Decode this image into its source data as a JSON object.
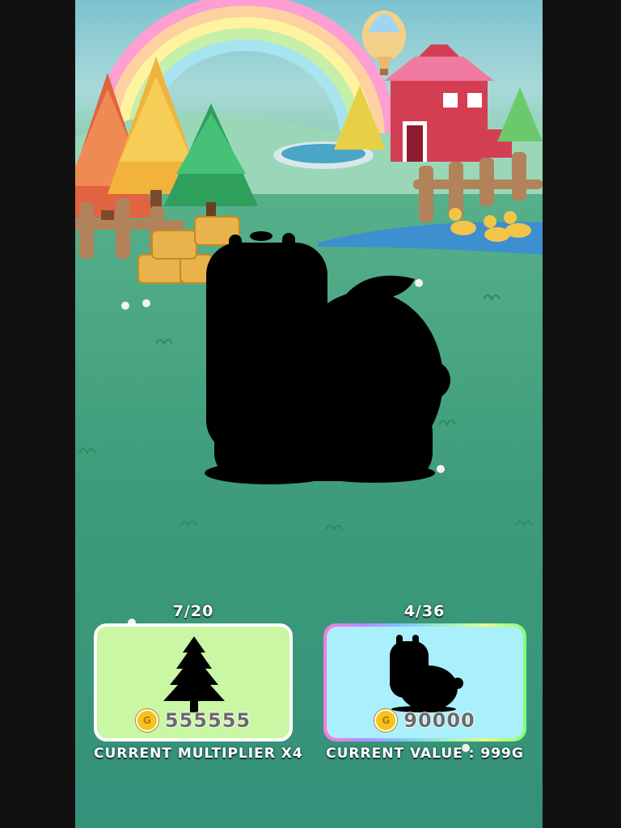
{
  "scene": {
    "pet_status": "undiscovered silhouette",
    "colors": {
      "card_tree_bg": "#c9f7a4",
      "card_pet_bg": "#aaeffc",
      "coin": "#f6c21c",
      "price_text": "#6b6b6b"
    }
  },
  "tree_slot": {
    "counter": "7/20",
    "icon": "tree-silhouette-icon",
    "price": "555555",
    "coin_symbol": "G",
    "caption": "CURRENT MULTIPLIER X4"
  },
  "pet_slot": {
    "counter": "4/36",
    "icon": "fluffy-pet-silhouette-icon",
    "price": "90000",
    "coin_symbol": "G",
    "caption": "CURRENT VALUE : 999G"
  }
}
